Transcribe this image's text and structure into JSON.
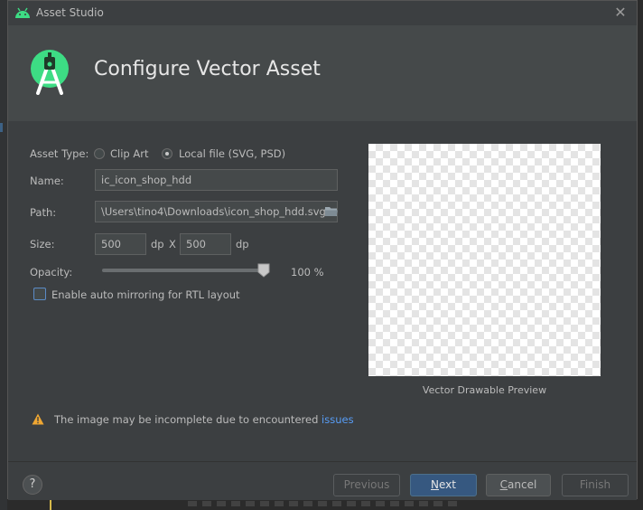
{
  "window": {
    "title": "Asset Studio"
  },
  "banner": {
    "heading": "Configure Vector Asset"
  },
  "form": {
    "asset_type_label": "Asset Type:",
    "asset_type_options": [
      "Clip Art",
      "Local file (SVG, PSD)"
    ],
    "asset_type_selected": "Local file (SVG, PSD)",
    "name_label": "Name:",
    "name_value": "ic_icon_shop_hdd",
    "path_label": "Path:",
    "path_value": "\\Users\\tino4\\Downloads\\icon_shop_hdd.svg",
    "size_label": "Size:",
    "width_value": "500",
    "height_value": "500",
    "unit": "dp",
    "separator": "X",
    "opacity_label": "Opacity:",
    "opacity_value": 100,
    "opacity_text": "100 %",
    "rtl_label": "Enable auto mirroring for RTL layout",
    "rtl_checked": false
  },
  "preview": {
    "caption": "Vector Drawable Preview"
  },
  "warning": {
    "text": "The image may be incomplete due to encountered ",
    "link": "issues"
  },
  "buttons": {
    "help": "?",
    "previous": "Previous",
    "next_first": "N",
    "next_rest": "ext",
    "cancel_first": "C",
    "cancel_rest": "ancel",
    "finish": "Finish"
  },
  "colors": {
    "accent": "#365880",
    "android_green": "#3ddc84",
    "link": "#589df6",
    "warning": "#f0a732"
  }
}
